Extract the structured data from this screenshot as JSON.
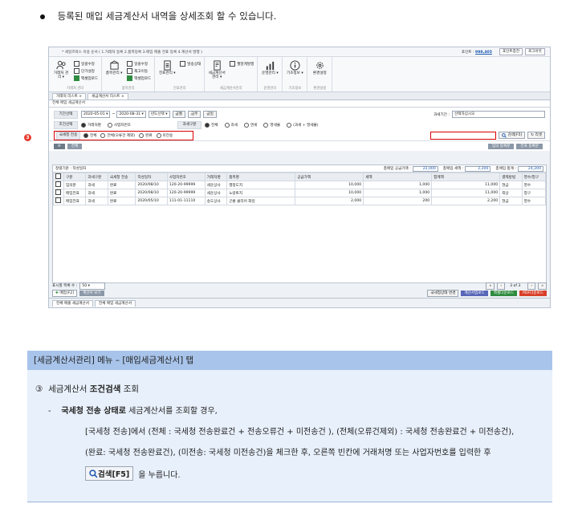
{
  "intro": "등록된 매입 세금계산서 내역을 상세조회 할 수 있습니다.",
  "app": {
    "announcement": "* 세일즈박스 이용 순서 ( 1.거래처 등록  2.품목등록  3.매입 매출 전표 등록  4.계산서 발행 )",
    "points_label": "포인트 :",
    "points_value": "998,405",
    "btn_charge": "포인트충전",
    "btn_logout": "로그아웃"
  },
  "ribbon": {
    "groups": [
      {
        "label": "거래처 관리",
        "big": "거래처 관리 ▾",
        "smalls": [
          "일괄수정",
          "단가설정",
          "엑셀업로드"
        ]
      },
      {
        "label": "품목관리",
        "big": "품목관리 ▾",
        "smalls": [
          "일괄수정",
          "재고이동",
          "엑셀업로드"
        ]
      },
      {
        "label": "전표관리",
        "big": "전표관리 ▾",
        "smalls": [
          "발송상태"
        ]
      },
      {
        "label": "세금계산서관리",
        "big": "세금계산서 관리 ▾",
        "smalls": [
          "월말계발행"
        ]
      },
      {
        "label": "운영관리",
        "big": "운영관리 ▾",
        "smalls": []
      },
      {
        "label": "기초정보",
        "big": "기초정보 ▾",
        "smalls": []
      },
      {
        "label": "환경설정",
        "big": "환경설정",
        "smalls": []
      }
    ]
  },
  "tabs": [
    "거래처 리스트",
    "세금계산서 리스트"
  ],
  "page_title": "전체 매입 세금계산서",
  "form": {
    "period_label": "기간선택",
    "date_from": "2020-05-01",
    "date_to": "2020-08-31",
    "year_select": "년도선택",
    "btn_month": "금월",
    "btn_week": "금주",
    "btn_today": "금일",
    "tax_period_label": "과세기간 :",
    "tax_period_value": "선택하십시오",
    "cond_label": "조건선택",
    "cond_opt1": "거래처명",
    "cond_opt2": "사업자번호",
    "tax_type_label": "과세구분",
    "tax_type_opts": [
      "전체",
      "과세",
      "면세",
      "영세율",
      "(과세 + 영세율)"
    ],
    "nts_label": "국세청 전송",
    "nts_opts": [
      "전체",
      "전체(오류건 제외)",
      "완료",
      "미전송"
    ],
    "search_btn": "검색[F5]",
    "reset_btn": "리셋",
    "badge": "3"
  },
  "actions": {
    "delete": "전체",
    "btn_reg": "임의 등록분",
    "btn_send": "전표 등록분"
  },
  "grid": {
    "filter": "정렬기준 : 작성일자",
    "sum_supply_label": "총매입 공급가액 :",
    "sum_supply": "22,000",
    "sum_tax_label": "총매입 세액 :",
    "sum_tax": "2,200",
    "sum_total_label": "총매입 합계 :",
    "sum_total": "24,200",
    "columns": [
      "구분",
      "과세구분",
      "국세청 전송",
      "작성일자",
      "사업자번호",
      "거래처명",
      "품목명",
      "공급가액",
      "세액",
      "합계액",
      "결제방법",
      "영수/청구"
    ],
    "rows": [
      [
        "임의분",
        "과세",
        "완료",
        "2020/08/10",
        "120-20-99999",
        "세운상사",
        "행정도지",
        "10,000",
        "1,000",
        "11,000",
        "현금",
        "영수"
      ],
      [
        "매입전표",
        "과세",
        "완료",
        "2020/08/10",
        "120-20-99999",
        "세운상사",
        "노랑토지",
        "10,000",
        "1,000",
        "11,000",
        "외상",
        "청구"
      ],
      [
        "매입전표",
        "과세",
        "완료",
        "2020/05/10",
        "111-01-11110",
        "송도상사",
        "곤룡 클리어 화일",
        "2,000",
        "200",
        "2,200",
        "현금",
        "영수"
      ]
    ],
    "page_size_label": "표시할 목록 수 :",
    "page_size": "50",
    "page_info": "3 of 3"
  },
  "footer": {
    "add_btn": "매입[F2]",
    "view_btn": "계산서 보기",
    "nts_change": "국세청상태 변경",
    "btn_upload": "계산서업로드",
    "btn_excel": "엑셀다운로드",
    "btn_pdf": "PDF다운로드",
    "bottom_tabs": [
      "전체 매출 세금계산서",
      "전체 매입 세금계산서"
    ]
  },
  "info": {
    "header": "[세금계산서관리] 메뉴 – [매입세금계산서] 탭",
    "l1_num": "③",
    "l1_pre": "세금계산서 ",
    "l1_bold": "조건검색",
    "l1_post": " 조회",
    "l2_dash": "-",
    "l2_bold": "국세청 전송 상태로",
    "l2_post": " 세금계산서를 조회할 경우,",
    "l3": "[국세청 전송]에서 (전체 : 국세청 전송완료건 + 전송오류건 + 미전송건 ), (전체(오류건제외) : 국세청 전송완료건 + 미전송건),",
    "l4": "(완료: 국세청 전송완료건), (미전송: 국세청 미전송건)을 체크한 후,  오른쪽 빈칸에 거래처명 또는 사업자번호를 입력한 후",
    "l5_btn": "검색[F5]",
    "l5_post": "을 누릅니다."
  }
}
